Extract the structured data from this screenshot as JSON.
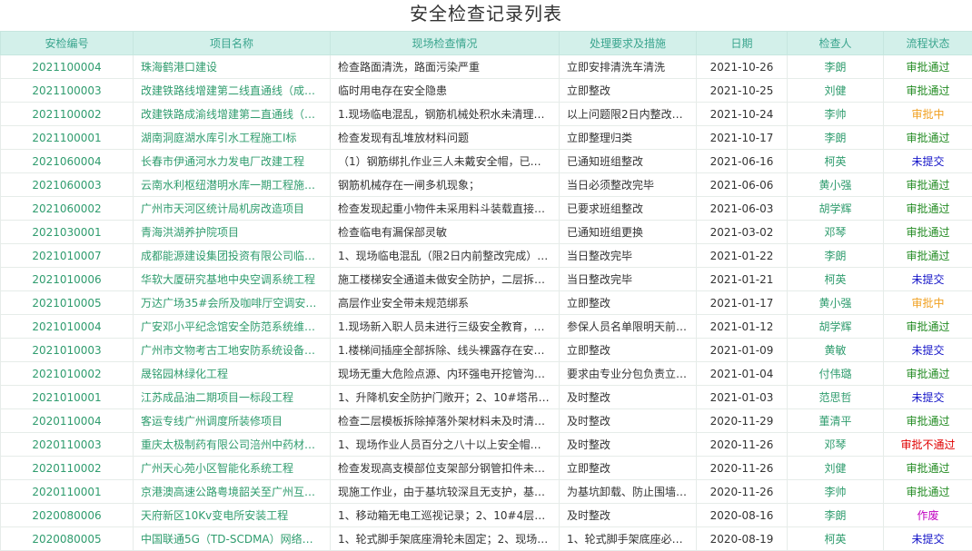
{
  "page_title": "安全检查记录列表",
  "columns": [
    "安检编号",
    "项目名称",
    "现场检查情况",
    "处理要求及措施",
    "日期",
    "检查人",
    "流程状态"
  ],
  "status_colors": {
    "审批通过": "#228b22",
    "审批中": "#f0a020",
    "未提交": "#1515c8",
    "审批不通过": "#e00000",
    "作废": "#c000c0"
  },
  "rows": [
    {
      "code": "2021100004",
      "project": "珠海鹤港口建设",
      "finding": "检查路面清洗，路面污染严重",
      "requirement": "立即安排清洗车清洗",
      "date": "2021-10-26",
      "inspector": "李朗",
      "status": "审批通过"
    },
    {
      "code": "2021100003",
      "project": "改建铁路线增建第二线直通线（成…",
      "finding": "临时用电存在安全隐患",
      "requirement": "立即整改",
      "date": "2021-10-25",
      "inspector": "刘健",
      "status": "审批通过"
    },
    {
      "code": "2021100002",
      "project": "改建铁路成渝线增建第二直通线（…",
      "finding": "1.现场临电混乱，钢筋机械处积水未清理…",
      "requirement": "以上问题限2日内整改…",
      "date": "2021-10-24",
      "inspector": "李帅",
      "status": "审批中"
    },
    {
      "code": "2021100001",
      "project": "湖南洞庭湖水库引水工程施工I标",
      "finding": "检查发现有乱堆放材料问题",
      "requirement": "立即整理归类",
      "date": "2021-10-17",
      "inspector": "李朗",
      "status": "审批通过"
    },
    {
      "code": "2021060004",
      "project": "长春市伊通河水力发电厂改建工程",
      "finding": "（1）钢筋绑扎作业三人未戴安全帽，已…",
      "requirement": "已通知班组整改",
      "date": "2021-06-16",
      "inspector": "柯英",
      "status": "未提交"
    },
    {
      "code": "2021060003",
      "project": "云南水利枢纽潜明水库一期工程施…",
      "finding": "钢筋机械存在一闸多机现象；",
      "requirement": "当日必须整改完毕",
      "date": "2021-06-06",
      "inspector": "黄小强",
      "status": "审批通过"
    },
    {
      "code": "2021060002",
      "project": "广州市天河区统计局机房改造项目",
      "finding": "检查发现起重小物件未采用料斗装载直接…",
      "requirement": "已要求班组整改",
      "date": "2021-06-03",
      "inspector": "胡学辉",
      "status": "审批通过"
    },
    {
      "code": "2021030001",
      "project": "青海洪湖养护院项目",
      "finding": "检查临电有漏保部灵敏",
      "requirement": "已通知班组更换",
      "date": "2021-03-02",
      "inspector": "邓琴",
      "status": "审批通过"
    },
    {
      "code": "2021010007",
      "project": "成都能源建设集团投资有限公司临…",
      "finding": "1、现场临电混乱（限2日内前整改完成）…",
      "requirement": "当日整改完毕",
      "date": "2021-01-22",
      "inspector": "李朗",
      "status": "审批通过"
    },
    {
      "code": "2021010006",
      "project": "华软大厦研究基地中央空调系统工程",
      "finding": "施工楼梯安全通道未做安全防护，二层拆…",
      "requirement": "当日整改完毕",
      "date": "2021-01-21",
      "inspector": "柯英",
      "status": "未提交"
    },
    {
      "code": "2021010005",
      "project": "万达广场35#会所及咖啡厅空调安…",
      "finding": "高层作业安全带未规范绑系",
      "requirement": "立即整改",
      "date": "2021-01-17",
      "inspector": "黄小强",
      "status": "审批中"
    },
    {
      "code": "2021010004",
      "project": "广安邓小平纪念馆安全防范系统维…",
      "finding": "1.现场新入职人员未进行三级安全教育，…",
      "requirement": "参保人员名单限明天前…",
      "date": "2021-01-12",
      "inspector": "胡学辉",
      "status": "审批通过"
    },
    {
      "code": "2021010003",
      "project": "广州市文物考古工地安防系统设备…",
      "finding": "1.楼梯间插座全部拆除、线头裸露存在安…",
      "requirement": "立即整改",
      "date": "2021-01-09",
      "inspector": "黄敏",
      "status": "未提交"
    },
    {
      "code": "2021010002",
      "project": "晟铭园林绿化工程",
      "finding": "现场无重大危险点源、内环强电开挖管沟…",
      "requirement": "要求由专业分包负责立…",
      "date": "2021-01-04",
      "inspector": "付伟璐",
      "status": "审批通过"
    },
    {
      "code": "2021010001",
      "project": "江苏成品油二期项目一标段工程",
      "finding": "1、升降机安全防护门敞开；2、10#塔吊…",
      "requirement": "及时整改",
      "date": "2021-01-03",
      "inspector": "范思哲",
      "status": "未提交"
    },
    {
      "code": "2020110004",
      "project": "客运专线广州调度所装修项目",
      "finding": "检查二层模板拆除掉落外架材料未及时清…",
      "requirement": "及时整改",
      "date": "2020-11-29",
      "inspector": "董清平",
      "status": "审批通过"
    },
    {
      "code": "2020110003",
      "project": "重庆太极制药有限公司涪州中药材…",
      "finding": "1、现场作业人员百分之八十以上安全帽…",
      "requirement": "及时整改",
      "date": "2020-11-26",
      "inspector": "邓琴",
      "status": "审批不通过"
    },
    {
      "code": "2020110002",
      "project": "广州天心苑小区智能化系统工程",
      "finding": "检查发现高支模部位支架部分钢管扣件未…",
      "requirement": "立即整改",
      "date": "2020-11-26",
      "inspector": "刘健",
      "status": "审批通过"
    },
    {
      "code": "2020110001",
      "project": "京港澳高速公路粤境韶关至广州互…",
      "finding": "现施工作业，由于基坑较深且无支护，基…",
      "requirement": "为基坑卸载、防止围墙…",
      "date": "2020-11-26",
      "inspector": "李帅",
      "status": "审批通过"
    },
    {
      "code": "2020080006",
      "project": "天府新区10Kv变电所安装工程",
      "finding": "1、移动箱无电工巡视记录；2、10#4层无…",
      "requirement": "及时整改",
      "date": "2020-08-16",
      "inspector": "李朗",
      "status": "作废"
    },
    {
      "code": "2020080005",
      "project": "中国联通5G（TD-SCDMA）网络…",
      "finding": "1、轮式脚手架底座滑轮未固定；2、现场…",
      "requirement": "1、轮式脚手架底座必…",
      "date": "2020-08-19",
      "inspector": "柯英",
      "status": "未提交"
    }
  ]
}
